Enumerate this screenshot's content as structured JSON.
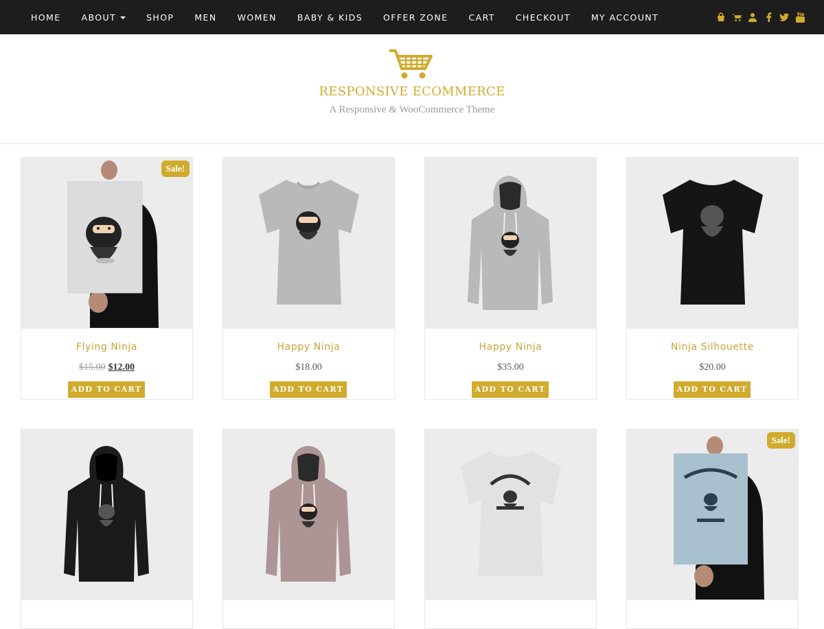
{
  "nav": {
    "items": [
      {
        "label": "HOME"
      },
      {
        "label": "ABOUT"
      },
      {
        "label": "SHOP"
      },
      {
        "label": "MEN"
      },
      {
        "label": "WOMEN"
      },
      {
        "label": "BABY & KIDS"
      },
      {
        "label": "OFFER ZONE"
      },
      {
        "label": "CART"
      },
      {
        "label": "CHECKOUT"
      },
      {
        "label": "MY ACCOUNT"
      }
    ],
    "icons": [
      "shopping-bag-icon",
      "cart-icon",
      "user-icon",
      "facebook-icon",
      "twitter-icon",
      "youtube-icon"
    ],
    "icon_color": "#d1ab2e"
  },
  "header": {
    "title": "RESPONSIVE ECOMMERCE",
    "tagline": "A Responsive & WooCommerce Theme",
    "accent": "#d1ab2e"
  },
  "products": [
    {
      "name": "Flying Ninja",
      "old_price": "$15.00",
      "price": "$12.00",
      "sale": "Sale!",
      "button": "ADD TO CART"
    },
    {
      "name": "Happy Ninja",
      "price": "$18.00",
      "button": "ADD TO CART"
    },
    {
      "name": "Happy Ninja",
      "price": "$35.00",
      "button": "ADD TO CART"
    },
    {
      "name": "Ninja Silhouette",
      "price": "$20.00",
      "button": "ADD TO CART"
    },
    {},
    {},
    {},
    {
      "sale": "Sale!"
    }
  ]
}
